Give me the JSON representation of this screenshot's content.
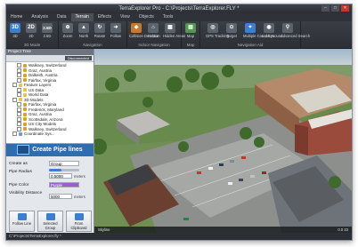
{
  "window": {
    "title": "TerraExplorer Pro - C:\\Projects\\TerraExplorer.FLY *"
  },
  "tabs": [
    "Home",
    "Analysis",
    "Data",
    "Terrain",
    "Effects",
    "View",
    "Objects",
    "Tools"
  ],
  "active_tab": "Home",
  "ribbon": {
    "groups": [
      {
        "label": "3D Mode",
        "buttons": [
          {
            "icon": "3D",
            "label": "3D"
          },
          {
            "icon": "2D",
            "label": "2D"
          },
          {
            "icon": "2.5D",
            "label": "2.5D"
          }
        ]
      },
      {
        "label": "Navigation",
        "buttons": [
          {
            "icon": "zoom-icon",
            "label": "Zoom"
          },
          {
            "icon": "north-icon",
            "label": "North"
          },
          {
            "icon": "rotate-icon",
            "label": "Rotate"
          },
          {
            "icon": "follow-icon",
            "label": "Follow"
          }
        ]
      },
      {
        "label": "Indoor Navigation",
        "buttons": [
          {
            "icon": "collision-icon",
            "label": "Collision Detection"
          },
          {
            "icon": "indoor-icon",
            "label": "Indoor"
          },
          {
            "icon": "hidden-areas-icon",
            "label": "Hidden Areas"
          }
        ]
      },
      {
        "label": "Map",
        "buttons": [
          {
            "icon": "map-icon",
            "label": "Map"
          }
        ]
      },
      {
        "label": "Navigation Aid",
        "buttons": [
          {
            "icon": "gps-icon",
            "label": "GPS Tracking"
          },
          {
            "icon": "target-icon",
            "label": "Target"
          },
          {
            "icon": "multiple-coord-icon",
            "label": "Multiple Coord Sys"
          },
          {
            "icon": "look-around-icon",
            "label": "Look Around"
          },
          {
            "icon": "adv-search-icon",
            "label": "Advanced Search"
          }
        ]
      }
    ]
  },
  "project_tree": {
    "title": "Project Tree",
    "toolbar_button": "Disconnected",
    "items": [
      {
        "label": "Walkney, Switzerland",
        "indent": 2,
        "color": "#d9a12c"
      },
      {
        "label": "Graz, Austria",
        "indent": 2,
        "color": "#d9a12c"
      },
      {
        "label": "Dalkeith, Austria",
        "indent": 2,
        "color": "#d9a12c"
      },
      {
        "label": "Fairfax, Virginia",
        "indent": 2,
        "color": "#d9a12c"
      },
      {
        "label": "Feature Layers",
        "indent": 1,
        "color": "#e8c24a"
      },
      {
        "label": "US Data",
        "indent": 2,
        "color": "#e8c24a"
      },
      {
        "label": "World Data",
        "indent": 2,
        "color": "#e8c24a"
      },
      {
        "label": "3D Models",
        "indent": 1,
        "color": "#e8c24a"
      },
      {
        "label": "Fairfax, Virginia",
        "indent": 2,
        "color": "#d9a12c"
      },
      {
        "label": "Frederick, Maryland",
        "indent": 2,
        "color": "#d9a12c"
      },
      {
        "label": "Graz, Austria",
        "indent": 2,
        "color": "#d9a12c"
      },
      {
        "label": "Scottsdale, Arizona",
        "indent": 2,
        "color": "#d9a12c"
      },
      {
        "label": "US City Models",
        "indent": 2,
        "color": "#d9a12c"
      },
      {
        "label": "Walkney, Switzerland",
        "indent": 2,
        "color": "#d9a12c"
      },
      {
        "label": "Coordinate Sys...",
        "indent": 1,
        "color": "#6a9ad4"
      }
    ]
  },
  "pipe_panel": {
    "title": "Create Pipe lines",
    "create_as_label": "Create as",
    "create_as_value": "Group",
    "pipe_radius_label": "Pipe Radius",
    "pipe_radius_value": "0.5000",
    "pipe_radius_unit": "meters",
    "pipe_color_label": "Pipe Color",
    "pipe_color_value": "Purple",
    "visibility_label": "Visibility Distance",
    "visibility_value": "5000",
    "visibility_unit": "meters",
    "buttons": [
      {
        "label": "Follow Line"
      },
      {
        "label": "Selected Group"
      },
      {
        "label": "From Clipboard"
      }
    ]
  },
  "status": {
    "left": "Skyline",
    "right": "0.0  23"
  },
  "bottom_bar": {
    "path": "C:\\Projects\\TerraExplorer.fly *"
  }
}
